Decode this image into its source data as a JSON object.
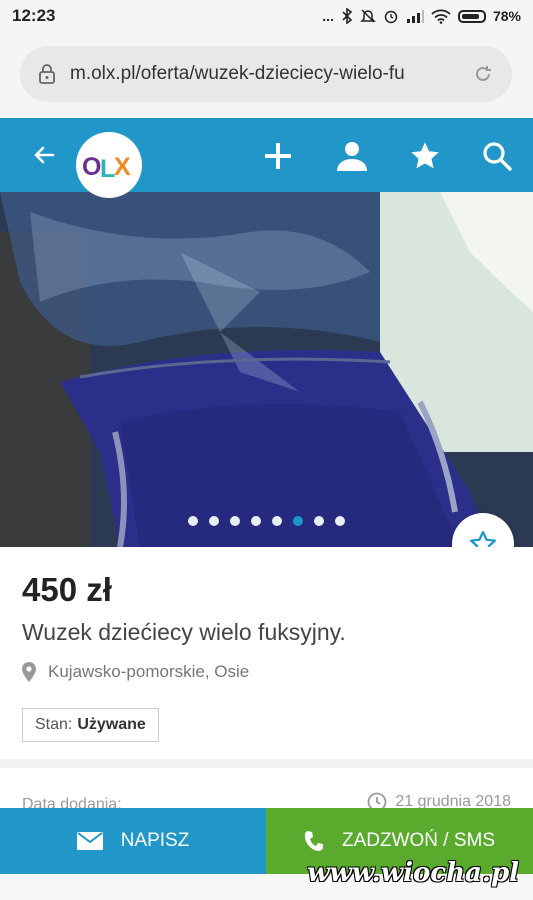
{
  "status_bar": {
    "time": "12:23",
    "dots": "...",
    "battery_percent": "78%"
  },
  "browser": {
    "url": "m.olx.pl/oferta/wuzek-dzieciecy-wielo-fu"
  },
  "nav": {
    "logo_text": "OLX"
  },
  "gallery": {
    "total_images": 8,
    "active_index": 5
  },
  "listing": {
    "price": "450 zł",
    "title": "Wuzek dziećiecy wielo fuksyjny.",
    "location": "Kujawsko-pomorskie, Osie",
    "state_label": "Stan:",
    "state_value": "Używane"
  },
  "details": {
    "added_label": "Data dodania:",
    "added_date": "21 grudnia 2018"
  },
  "actions": {
    "write_label": "NAPISZ",
    "call_label": "ZADZWOŃ / SMS"
  },
  "watermark": "www.wiocha.pl",
  "colors": {
    "brand_blue": "#2196c9",
    "call_green": "#5aaa2d",
    "active_dot": "#1f94cc"
  }
}
